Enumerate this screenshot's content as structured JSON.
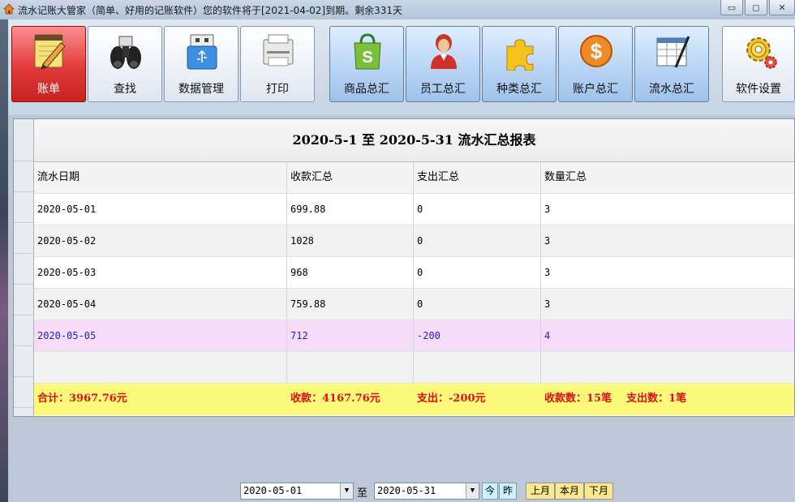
{
  "window": {
    "title": "流水记账大管家（简单、好用的记账软件）您的软件将于[2021-04-02]到期。剩余331天",
    "minimize": "▭",
    "restore": "◻",
    "close": "✕"
  },
  "toolbar": {
    "buttons": [
      {
        "label": "账单",
        "icon": "notepad-pencil-icon",
        "active": true
      },
      {
        "label": "查找",
        "icon": "binoculars-icon"
      },
      {
        "label": "数据管理",
        "icon": "usb-drive-icon"
      },
      {
        "label": "打印",
        "icon": "printer-icon"
      },
      {
        "label": "商品总汇",
        "icon": "shopping-bag-icon"
      },
      {
        "label": "员工总汇",
        "icon": "person-icon"
      },
      {
        "label": "种类总汇",
        "icon": "puzzle-icon"
      },
      {
        "label": "账户总汇",
        "icon": "dollar-coin-icon"
      },
      {
        "label": "流水总汇",
        "icon": "spreadsheet-pen-icon"
      },
      {
        "label": "软件设置",
        "icon": "gear-icon"
      }
    ]
  },
  "report": {
    "title": "2020-5-1 至 2020-5-31 流水汇总报表",
    "columns": [
      "流水日期",
      "收款汇总",
      "支出汇总",
      "数量汇总"
    ],
    "rows": [
      [
        "2020-05-01",
        "699.88",
        "0",
        "3"
      ],
      [
        "2020-05-02",
        "1028",
        "0",
        "3"
      ],
      [
        "2020-05-03",
        "968",
        "0",
        "3"
      ],
      [
        "2020-05-04",
        "759.88",
        "0",
        "3"
      ],
      [
        "2020-05-05",
        "712",
        "-200",
        "4"
      ]
    ],
    "totals": {
      "total": "合计：3967.76元",
      "income": "收款：4167.76元",
      "expense": "支出：-200元",
      "income_count": "收款数：15笔",
      "expense_count": "支出数：1笔"
    }
  },
  "filter": {
    "start_date": "2020-05-01",
    "end_date": "2020-05-31",
    "to_label": "至",
    "today": "今",
    "yesterday": "昨",
    "last_month": "上月",
    "this_month": "本月",
    "next_month": "下月"
  },
  "colors": {
    "active_button": "#e23a3a",
    "blue_button": "#b9d5f5",
    "selected_row": "#f7dcf8",
    "total_row": "#fcf87a",
    "total_text": "#e01010"
  }
}
